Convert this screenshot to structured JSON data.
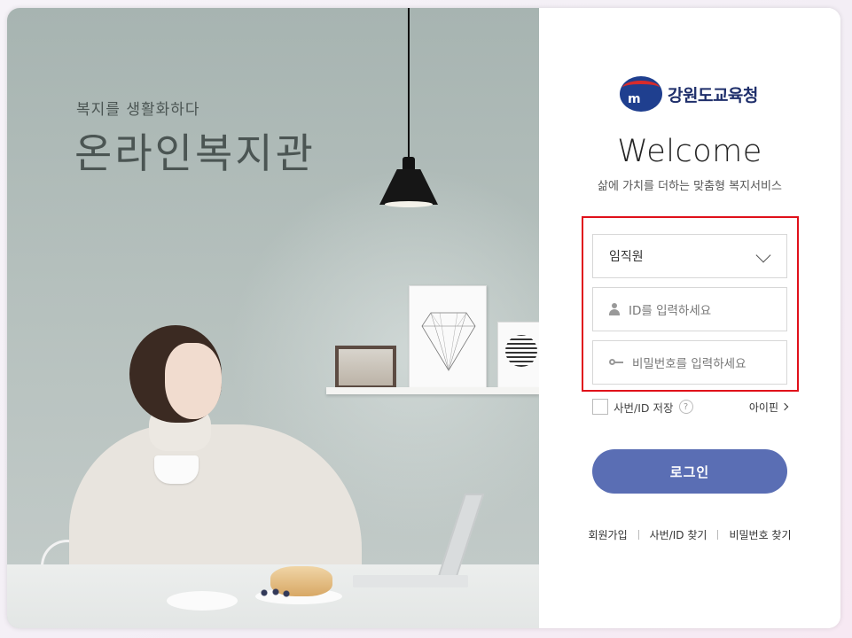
{
  "hero": {
    "tagline": "복지를 생활화하다",
    "headline": "온라인복지관"
  },
  "logo": {
    "emblem_mark": "m",
    "name": "강원도교육청"
  },
  "welcome": {
    "title": "Welcome",
    "subtitle": "삶에 가치를 더하는 맞춤형 복지서비스"
  },
  "form": {
    "user_type": {
      "selected": "임직원"
    },
    "id_field": {
      "placeholder": "ID를 입력하세요",
      "icon": "user-icon"
    },
    "password_field": {
      "placeholder": "비밀번호를 입력하세요",
      "icon": "key-icon"
    },
    "save_id_label": "사번/ID 저장",
    "help_glyph": "?",
    "ipin_label": "아이핀",
    "login_button": "로그인",
    "highlight_color": "#e0101a"
  },
  "footer_links": [
    "회원가입",
    "사번/ID 찾기",
    "비밀번호 찾기"
  ],
  "colors": {
    "accent": "#5a6eb4",
    "logo_blue": "#1f3f8f",
    "logo_red": "#d72b2b"
  }
}
